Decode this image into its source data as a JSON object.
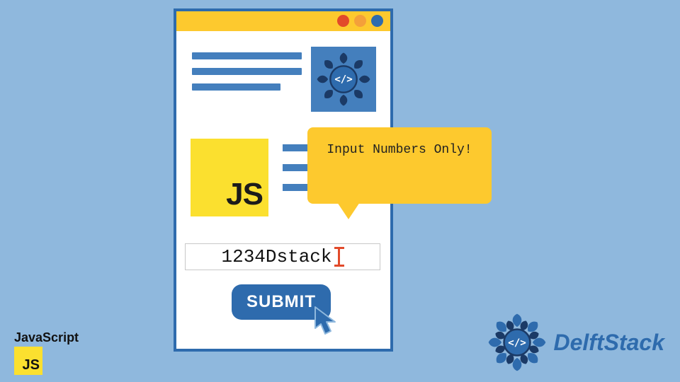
{
  "tooltip": {
    "message": "Input Numbers Only!"
  },
  "input": {
    "value": "1234Dstack"
  },
  "submit": {
    "label": "SUBMIT"
  },
  "js_block": {
    "text": "JS"
  },
  "bottom_left": {
    "label": "JavaScript",
    "badge": "JS"
  },
  "brand": {
    "name": "DelftStack"
  },
  "colors": {
    "bg": "#8fb8dd",
    "blue": "#2e6bad",
    "blue_light": "#447fbd",
    "yellow": "#fdc92e",
    "js_yellow": "#fbe02f",
    "red": "#e24a2a",
    "orange": "#f4a03a"
  }
}
